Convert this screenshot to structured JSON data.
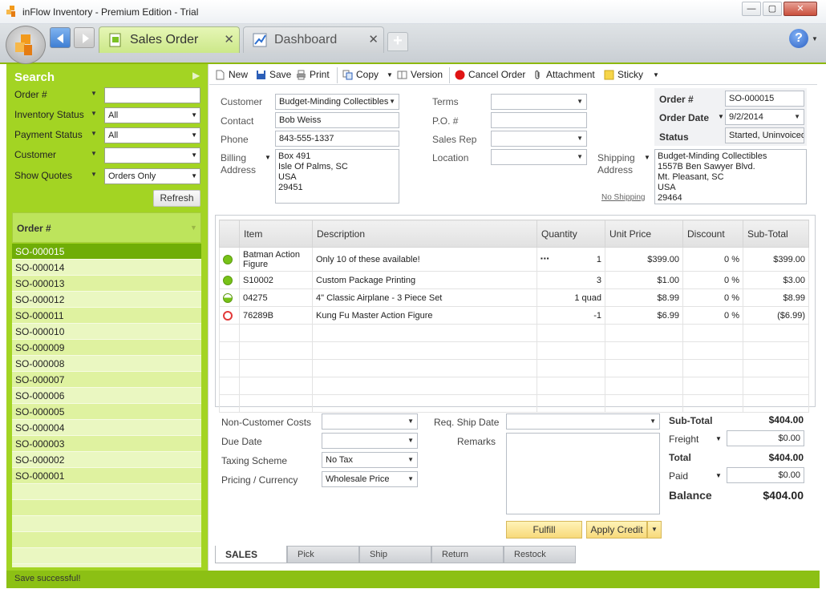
{
  "window": {
    "title": "inFlow Inventory - Premium Edition - Trial",
    "minimize": "—",
    "restore": "▢",
    "close": "✕"
  },
  "tabs": [
    {
      "label": "Sales Order",
      "close": "✕"
    },
    {
      "label": "Dashboard",
      "close": "✕"
    }
  ],
  "tab_add": "+",
  "help": "?",
  "search": {
    "title": "Search",
    "filters": [
      {
        "label": "Order #",
        "value": ""
      },
      {
        "label": "Inventory Status",
        "value": "All"
      },
      {
        "label": "Payment Status",
        "value": "All"
      },
      {
        "label": "Customer",
        "value": ""
      },
      {
        "label": "Show Quotes",
        "value": "Orders Only"
      }
    ],
    "refresh": "Refresh"
  },
  "orders": {
    "header": "Order #",
    "items": [
      "SO-000015",
      "SO-000014",
      "SO-000013",
      "SO-000012",
      "SO-000011",
      "SO-000010",
      "SO-000009",
      "SO-000008",
      "SO-000007",
      "SO-000006",
      "SO-000005",
      "SO-000004",
      "SO-000003",
      "SO-000002",
      "SO-000001"
    ],
    "selected": "SO-000015"
  },
  "toolbar": {
    "new": "New",
    "save": "Save",
    "print": "Print",
    "copy": "Copy",
    "version": "Version",
    "cancel_order": "Cancel Order",
    "attachment": "Attachment",
    "sticky": "Sticky"
  },
  "form": {
    "customer_label": "Customer",
    "customer": "Budget-Minding Collectibles",
    "contact_label": "Contact",
    "contact": "Bob Weiss",
    "phone_label": "Phone",
    "phone": "843-555-1337",
    "billing_label_1": "Billing",
    "billing_label_2": "Address",
    "billing_address": [
      "Box 491",
      "Isle Of Palms, SC",
      "USA",
      "29451"
    ],
    "terms_label": "Terms",
    "po_label": "P.O. #",
    "sales_rep_label": "Sales Rep",
    "location_label": "Location",
    "shipping_label_1": "Shipping",
    "shipping_label_2": "Address",
    "no_shipping": "No Shipping",
    "shipping_address": [
      "Budget-Minding Collectibles",
      "1557B Ben Sawyer Blvd.",
      "Mt. Pleasant, SC",
      "USA",
      "29464"
    ],
    "order_no_label": "Order #",
    "order_no": "SO-000015",
    "order_date_label": "Order Date",
    "order_date": "9/2/2014",
    "status_label": "Status",
    "status": "Started, Uninvoiced"
  },
  "items_table": {
    "columns": [
      "Item",
      "Description",
      "Quantity",
      "Unit Price",
      "Discount",
      "Sub-Total"
    ],
    "rows": [
      {
        "status": "full",
        "item": "Batman Action Figure",
        "description": "Only 10 of these available!",
        "qty": "1",
        "price": "$399.00",
        "discount": "0 %",
        "subtotal": "$399.00"
      },
      {
        "status": "full",
        "item": "S10002",
        "description": "Custom Package Printing",
        "qty": "3",
        "price": "$1.00",
        "discount": "0 %",
        "subtotal": "$3.00"
      },
      {
        "status": "half",
        "item": "04275",
        "description": "4\" Classic Airplane - 3 Piece Set",
        "qty": "1 quad",
        "price": "$8.99",
        "discount": "0 %",
        "subtotal": "$8.99"
      },
      {
        "status": "empty",
        "item": "76289B",
        "description": "Kung Fu Master Action Figure",
        "qty": "-1",
        "price": "$6.99",
        "discount": "0 %",
        "subtotal": "($6.99)"
      }
    ],
    "more_icon": "▪▪▪"
  },
  "lower": {
    "non_customer_costs": "Non-Customer Costs",
    "due_date": "Due Date",
    "taxing_scheme": "Taxing Scheme",
    "taxing_value": "No Tax",
    "pricing_currency": "Pricing / Currency",
    "pricing_value": "Wholesale Price",
    "req_ship_date": "Req. Ship Date",
    "remarks": "Remarks",
    "fulfill": "Fulfill",
    "apply_credit": "Apply Credit"
  },
  "summary": {
    "subtotal_label": "Sub-Total",
    "subtotal": "$404.00",
    "freight_label": "Freight",
    "freight": "$0.00",
    "total_label": "Total",
    "total": "$404.00",
    "paid_label": "Paid",
    "paid": "$0.00",
    "balance_label": "Balance",
    "balance": "$404.00"
  },
  "bottom_tabs": [
    "SALES",
    "Pick",
    "Ship",
    "Return",
    "Restock"
  ],
  "status_bar": "Save successful!"
}
